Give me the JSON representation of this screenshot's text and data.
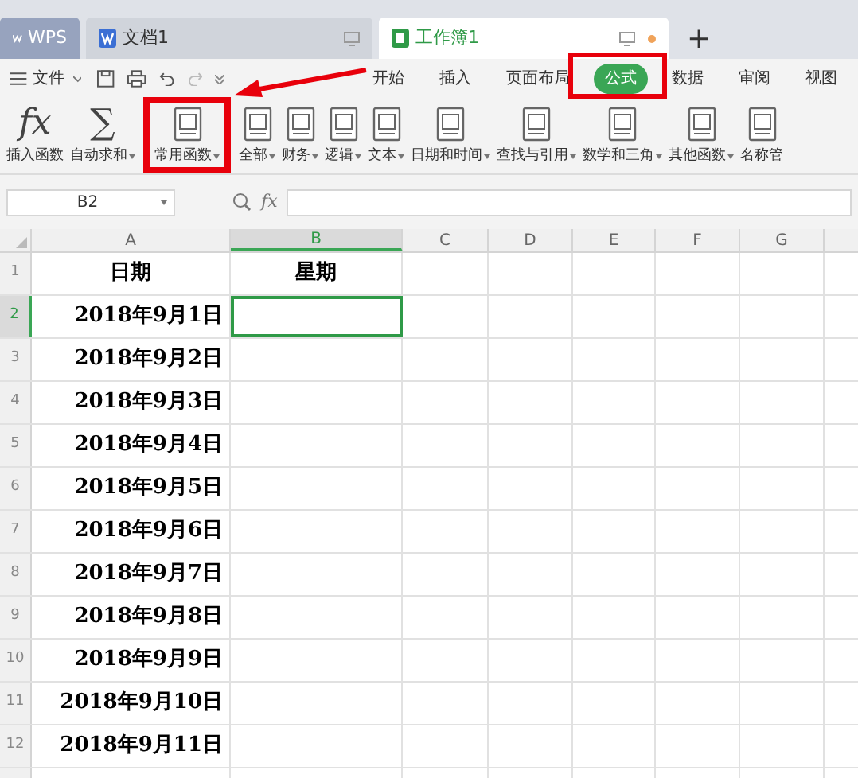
{
  "title_tabs": [
    {
      "label": "WPS",
      "kind": "home"
    },
    {
      "label": "文档1",
      "kind": "writer",
      "selected": false
    },
    {
      "label": "工作簿1",
      "kind": "sheet",
      "selected": true,
      "unsaved": true
    }
  ],
  "new_tab": "+",
  "menu": {
    "file": "文件",
    "tabs": [
      {
        "label": "开始",
        "selected": false
      },
      {
        "label": "插入",
        "selected": false
      },
      {
        "label": "页面布局",
        "selected": false
      },
      {
        "label": "公式",
        "selected": true
      },
      {
        "label": "数据",
        "selected": false
      },
      {
        "label": "审阅",
        "selected": false
      },
      {
        "label": "视图",
        "selected": false
      }
    ]
  },
  "ribbon": [
    {
      "label": "插入函数",
      "kind": "glyph",
      "glyph": "fx",
      "dropdown": false,
      "highlighted": false
    },
    {
      "label": "自动求和",
      "kind": "glyph",
      "glyph": "∑",
      "dropdown": true,
      "highlighted": false
    },
    {
      "label": "常用函数",
      "kind": "doc",
      "dropdown": true,
      "highlighted": true
    },
    {
      "label": "全部",
      "kind": "doc",
      "dropdown": true,
      "highlighted": false
    },
    {
      "label": "财务",
      "kind": "doc",
      "dropdown": true,
      "highlighted": false
    },
    {
      "label": "逻辑",
      "kind": "doc",
      "dropdown": true,
      "highlighted": false
    },
    {
      "label": "文本",
      "kind": "doc",
      "dropdown": true,
      "highlighted": false
    },
    {
      "label": "日期和时间",
      "kind": "doc",
      "dropdown": true,
      "highlighted": false
    },
    {
      "label": "查找与引用",
      "kind": "doc",
      "dropdown": true,
      "highlighted": false
    },
    {
      "label": "数学和三角",
      "kind": "doc",
      "dropdown": true,
      "highlighted": false
    },
    {
      "label": "其他函数",
      "kind": "doc",
      "dropdown": true,
      "highlighted": false
    },
    {
      "label": "名称管",
      "kind": "doc",
      "dropdown": false,
      "highlighted": false
    }
  ],
  "formula_bar": {
    "name_box": "B2",
    "fx": "fx"
  },
  "columns": [
    {
      "label": "A",
      "selected": false
    },
    {
      "label": "B",
      "selected": true
    },
    {
      "label": "C",
      "selected": false
    },
    {
      "label": "D",
      "selected": false
    },
    {
      "label": "E",
      "selected": false
    },
    {
      "label": "F",
      "selected": false
    },
    {
      "label": "G",
      "selected": false
    }
  ],
  "rows": [
    {
      "number": "1",
      "selected": false,
      "cells": [
        {
          "text": "日期",
          "selected": false
        },
        {
          "text": "星期",
          "selected": false
        }
      ]
    },
    {
      "number": "2",
      "selected": true,
      "cells": [
        {
          "text": "2018年9月1日",
          "selected": false
        },
        {
          "selected": true
        }
      ]
    },
    {
      "number": "3",
      "selected": false,
      "cells": [
        {
          "text": "2018年9月2日",
          "selected": false
        },
        {
          "selected": false
        }
      ]
    },
    {
      "number": "4",
      "selected": false,
      "cells": [
        {
          "text": "2018年9月3日",
          "selected": false
        },
        {
          "selected": false
        }
      ]
    },
    {
      "number": "5",
      "selected": false,
      "cells": [
        {
          "text": "2018年9月4日",
          "selected": false
        },
        {
          "selected": false
        }
      ]
    },
    {
      "number": "6",
      "selected": false,
      "cells": [
        {
          "text": "2018年9月5日",
          "selected": false
        },
        {
          "selected": false
        }
      ]
    },
    {
      "number": "7",
      "selected": false,
      "cells": [
        {
          "text": "2018年9月6日",
          "selected": false
        },
        {
          "selected": false
        }
      ]
    },
    {
      "number": "8",
      "selected": false,
      "cells": [
        {
          "text": "2018年9月7日",
          "selected": false
        },
        {
          "selected": false
        }
      ]
    },
    {
      "number": "9",
      "selected": false,
      "cells": [
        {
          "text": "2018年9月8日",
          "selected": false
        },
        {
          "selected": false
        }
      ]
    },
    {
      "number": "10",
      "selected": false,
      "cells": [
        {
          "text": "2018年9月9日",
          "selected": false
        },
        {
          "selected": false
        }
      ]
    },
    {
      "number": "11",
      "selected": false,
      "cells": [
        {
          "text": "2018年9月10日",
          "selected": false
        },
        {
          "selected": false
        }
      ]
    },
    {
      "number": "12",
      "selected": false,
      "cells": [
        {
          "text": "2018年9月11日",
          "selected": false
        },
        {
          "selected": false
        }
      ]
    }
  ]
}
